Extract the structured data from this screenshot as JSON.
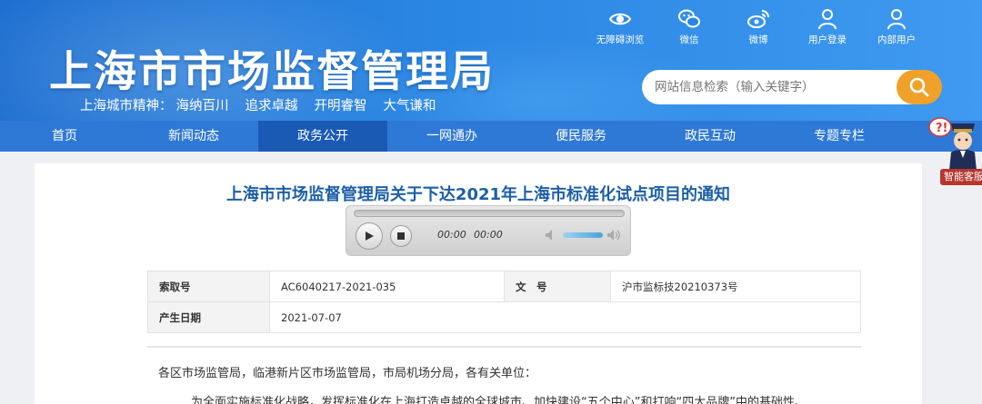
{
  "header": {
    "site_title": "上海市市场监督管理局",
    "slogan_label": "上海城市精神：",
    "slogan_items": [
      "海纳百川",
      "追求卓越",
      "开明睿智",
      "大气谦和"
    ],
    "tools": [
      {
        "label": "无障碍浏览",
        "icon": "eye-icon"
      },
      {
        "label": "微信",
        "icon": "wechat-icon"
      },
      {
        "label": "微博",
        "icon": "weibo-icon"
      },
      {
        "label": "用户登录",
        "icon": "user-icon"
      },
      {
        "label": "内部用户",
        "icon": "user-icon"
      }
    ],
    "search": {
      "placeholder": "网站信息检索（输入关键字）",
      "icon": "search-icon"
    }
  },
  "nav": {
    "items": [
      "首页",
      "新闻动态",
      "政务公开",
      "一网通办",
      "便民服务",
      "政民互动",
      "专题专栏"
    ],
    "active_index": 2
  },
  "assistant": {
    "label": "智能客服"
  },
  "article": {
    "title": "上海市市场监督管理局关于下达2021年上海市标准化试点项目的通知",
    "player": {
      "current_time": "00:00",
      "duration": "00:00"
    },
    "meta": {
      "index_label": "索取号",
      "index_value": "AC6040217-2021-035",
      "doc_no_label": "文　号",
      "doc_no_value": "沪市监标技20210373号",
      "date_label": "产生日期",
      "date_value": "2021-07-07"
    },
    "para1": "各区市场监管局，临港新片区市场监管局，市局机场分局，各有关单位：",
    "para2": "为全面实施标准化战略，发挥标准化在上海打造卓越的全球城市、加快建设“五个中心”和打响“四大品牌”中的基础性、"
  },
  "colors": {
    "nav_bg": "#2f79d6",
    "nav_active": "#1a5ab4",
    "search_button": "#f0a12a",
    "title_text": "#1d5fa8"
  }
}
